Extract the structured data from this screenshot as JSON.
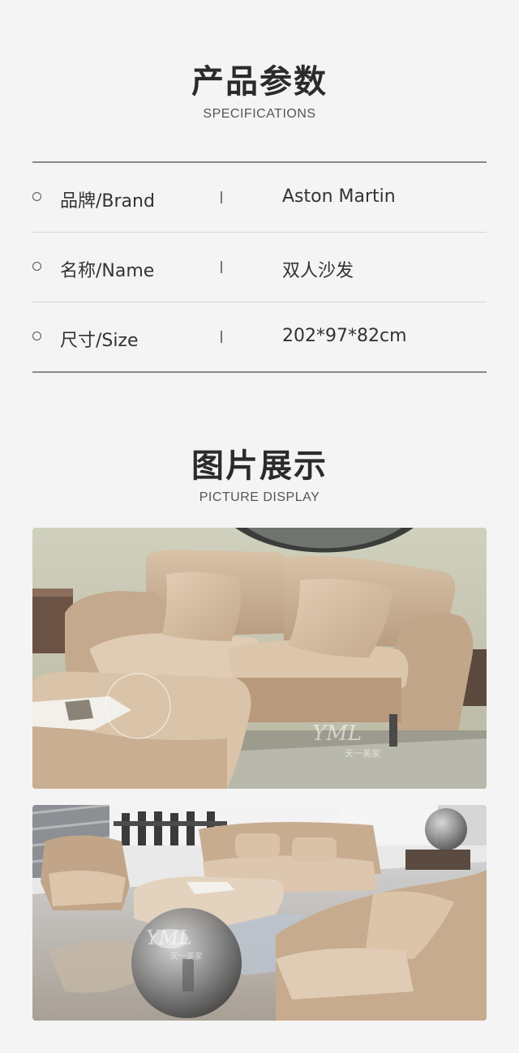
{
  "specs": {
    "title": "产品参数",
    "subtitle": "SPECIFICATIONS",
    "rows": [
      {
        "label": "品牌/Brand",
        "value": "Aston Martin"
      },
      {
        "label": "名称/Name",
        "value": "双人沙发"
      },
      {
        "label": "尺寸/Size",
        "value": "202*97*82cm"
      }
    ]
  },
  "gallery": {
    "title": "图片展示",
    "subtitle": "PICTURE DISPLAY",
    "images": [
      {
        "name": "sofa-closeup-photo",
        "watermark": "YML",
        "watermark_sub": "天一美家"
      },
      {
        "name": "sofa-set-showroom-photo",
        "watermark": "YML",
        "watermark_sub": "天一美家"
      }
    ]
  },
  "colors": {
    "background": "#f4f4f4",
    "leather": "#c9ae92",
    "leather_light": "#ddc7ae",
    "text": "#333333"
  }
}
